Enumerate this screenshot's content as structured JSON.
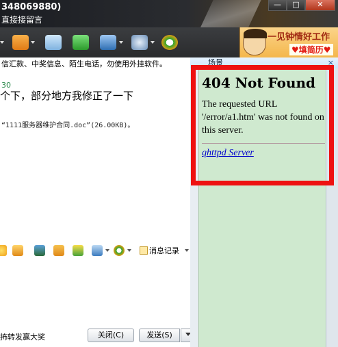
{
  "window": {
    "title": "348069880)",
    "subtitle": "直接接留言",
    "controls": {
      "minimize": "—",
      "maximize": "□",
      "close": "✕"
    }
  },
  "ad": {
    "line1": "一见钟情好工作",
    "line2": "♥填简历♥"
  },
  "toolbar": {
    "icons": [
      "folder-icon",
      "mail-icon",
      "add-icon",
      "hat-icon",
      "gear-icon",
      "soso-icon"
    ]
  },
  "notice": {
    "text": "信汇款、中奖信息、陌生电话，勿使用外挂软件。"
  },
  "chat": {
    "time": "30",
    "message": "个下，部分地方我修正了一下",
    "file_note": "“1111服务器维护合同.doc”(26.00KB)。"
  },
  "input_toolbar": {
    "history_label": "消息记录",
    "icons": [
      "emoji-icon",
      "thumbs-up-icon",
      "image-icon",
      "music-icon",
      "gift-icon",
      "screen-icon",
      "soso-icon"
    ]
  },
  "bottom": {
    "promo": "抪转发赢大奖",
    "close_button": "关闭(C)",
    "send_button": "发送(S)"
  },
  "side_panel": {
    "header": "场景",
    "close": "×",
    "error_title": "404 Not Found",
    "error_message": "The requested URL '/error/a1.htm' was not found on this server.",
    "server_link": "qhttpd Server"
  }
}
